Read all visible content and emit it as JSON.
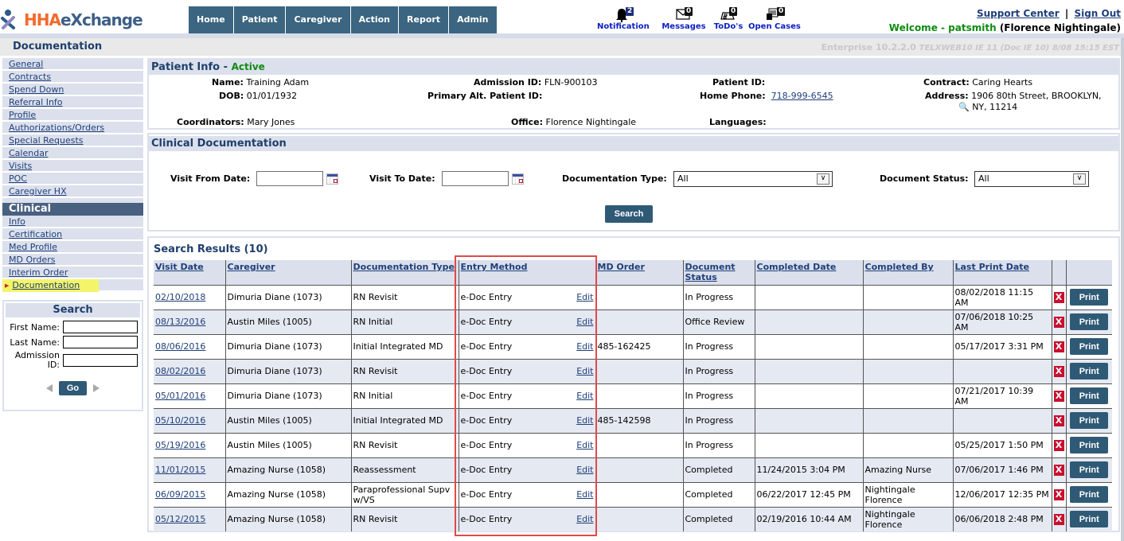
{
  "header": {
    "logo": {
      "part1": "HHA",
      "part2": "eXchange"
    },
    "nav": [
      "Home",
      "Patient",
      "Caregiver",
      "Action",
      "Report",
      "Admin"
    ],
    "notifications": [
      {
        "label": "Notification",
        "count": "2",
        "icon": "bell-icon"
      },
      {
        "label": "Messages",
        "count": "0",
        "icon": "envelope-icon"
      },
      {
        "label": "ToDo's",
        "count": "0",
        "icon": "todo-icon"
      },
      {
        "label": "Open Cases",
        "count": "0",
        "icon": "folder-icon"
      }
    ],
    "support_link": "Support Center",
    "separator": "|",
    "signout_link": "Sign Out",
    "welcome_prefix": "Welcome - patsmith",
    "welcome_name": "(Florence Nightingale)"
  },
  "titlebar": {
    "page_title": "Documentation",
    "version": "Enterprise 10.2.2.0",
    "server_info": "TELXWEB10 IE 11 (Doc IE 10) 8/08 15:15 EST"
  },
  "sidebar": {
    "items": [
      "General",
      "Contracts",
      "Spend Down",
      "Referral Info",
      "Profile",
      "Authorizations/Orders",
      "Special Requests",
      "Calendar",
      "Visits",
      "POC",
      "Caregiver HX"
    ],
    "clinical_heading": "Clinical",
    "clinical_items": [
      "Info",
      "Certification",
      "Med Profile",
      "MD Orders",
      "Interim Order"
    ],
    "active_item": "Documentation"
  },
  "search": {
    "title": "Search",
    "first_name_label": "First Name:",
    "last_name_label": "Last Name:",
    "admission_label": "Admission ID:",
    "first_name_value": "",
    "last_name_value": "",
    "admission_value": "",
    "go_label": "Go"
  },
  "patient_info": {
    "title": "Patient Info - ",
    "status": "Active",
    "name_label": "Name:",
    "name": "Training Adam",
    "dob_label": "DOB:",
    "dob": "01/01/1932",
    "coordinators_label": "Coordinators:",
    "coordinators": "Mary Jones",
    "admission_id_label": "Admission ID:",
    "admission_id": "FLN-900103",
    "alt_id_label": "Primary Alt. Patient ID:",
    "alt_id": "",
    "office_label": "Office:",
    "office": "Florence Nightingale",
    "patient_id_label": "Patient ID:",
    "patient_id": "",
    "phone_label": "Home Phone:",
    "phone": "718-999-6545",
    "languages_label": "Languages:",
    "languages": "",
    "contract_label": "Contract:",
    "contract": "Caring Hearts",
    "address_label": "Address:",
    "address_line1": "1906 80th Street, BROOKLYN,",
    "address_line2": "NY, 11214"
  },
  "clinical_doc": {
    "title": "Clinical Documentation",
    "visit_from_label": "Visit From Date:",
    "visit_from_value": "",
    "visit_to_label": "Visit To Date:",
    "visit_to_value": "",
    "doc_type_label": "Documentation Type:",
    "doc_type_value": "All",
    "doc_status_label": "Document Status:",
    "doc_status_value": "All",
    "search_label": "Search"
  },
  "results": {
    "title": "Search Results (10)",
    "columns": [
      "Visit Date",
      "Caregiver",
      "Documentation Type",
      "Entry Method",
      "MD Order",
      "Document Status",
      "Completed Date",
      "Completed By",
      "Last Print Date",
      "",
      ""
    ],
    "edit_label": "Edit",
    "print_label": "Print",
    "delete_label": "X",
    "rows": [
      {
        "visit_date": "02/10/2018",
        "caregiver": "Dimuria Diane (1073)",
        "doc_type": "RN Revisit",
        "entry": "e-Doc Entry",
        "md_order": "",
        "status": "In Progress",
        "completed_date": "",
        "completed_by": "",
        "last_print": "08/02/2018 11:15 AM"
      },
      {
        "visit_date": "08/13/2016",
        "caregiver": "Austin Miles (1005)",
        "doc_type": "RN Initial",
        "entry": "e-Doc Entry",
        "md_order": "",
        "status": "Office Review",
        "completed_date": "",
        "completed_by": "",
        "last_print": "07/06/2018 10:25 AM"
      },
      {
        "visit_date": "08/06/2016",
        "caregiver": "Dimuria Diane (1073)",
        "doc_type": "Initial Integrated MD",
        "entry": "e-Doc Entry",
        "md_order": "485-162425",
        "status": "In Progress",
        "completed_date": "",
        "completed_by": "",
        "last_print": "05/17/2017 3:31 PM"
      },
      {
        "visit_date": "08/02/2016",
        "caregiver": "Dimuria Diane (1073)",
        "doc_type": "RN Revisit",
        "entry": "e-Doc Entry",
        "md_order": "",
        "status": "In Progress",
        "completed_date": "",
        "completed_by": "",
        "last_print": ""
      },
      {
        "visit_date": "05/01/2016",
        "caregiver": "Dimuria Diane (1073)",
        "doc_type": "RN Initial",
        "entry": "e-Doc Entry",
        "md_order": "",
        "status": "In Progress",
        "completed_date": "",
        "completed_by": "",
        "last_print": "07/21/2017 10:39 AM"
      },
      {
        "visit_date": "05/10/2016",
        "caregiver": "Austin Miles (1005)",
        "doc_type": "Initial Integrated MD",
        "entry": "e-Doc Entry",
        "md_order": "485-142598",
        "status": "In Progress",
        "completed_date": "",
        "completed_by": "",
        "last_print": ""
      },
      {
        "visit_date": "05/19/2016",
        "caregiver": "Austin Miles (1005)",
        "doc_type": "RN Revisit",
        "entry": "e-Doc Entry",
        "md_order": "",
        "status": "In Progress",
        "completed_date": "",
        "completed_by": "",
        "last_print": "05/25/2017 1:50 PM"
      },
      {
        "visit_date": "11/01/2015",
        "caregiver": "Amazing Nurse (1058)",
        "doc_type": "Reassessment",
        "entry": "e-Doc Entry",
        "md_order": "",
        "status": "Completed",
        "completed_date": "11/24/2015 3:04 PM",
        "completed_by": "Amazing Nurse",
        "last_print": "07/06/2017 1:46 PM"
      },
      {
        "visit_date": "06/09/2015",
        "caregiver": "Amazing Nurse (1058)",
        "doc_type": "Paraprofessional Supv w/VS",
        "entry": "e-Doc Entry",
        "md_order": "",
        "status": "Completed",
        "completed_date": "06/22/2017 12:45 PM",
        "completed_by": "Nightingale Florence",
        "last_print": "12/06/2017 12:35 PM"
      },
      {
        "visit_date": "05/12/2015",
        "caregiver": "Amazing Nurse (1058)",
        "doc_type": "RN Revisit",
        "entry": "e-Doc Entry",
        "md_order": "",
        "status": "Completed",
        "completed_date": "02/19/2016 10:44 AM",
        "completed_by": "Nightingale Florence",
        "last_print": "06/06/2018 2:48 PM"
      }
    ]
  },
  "colors": {
    "nav_bg": "#3b6580",
    "button_bg": "#2f5a76",
    "panel_header_bg": "#dbe0ec",
    "active_green": "#118a11",
    "link_blue": "#1f3f7a",
    "highlight_yellow": "#f4f46a",
    "annotation_red": "#e04a4a",
    "delete_red": "#c8102e"
  }
}
